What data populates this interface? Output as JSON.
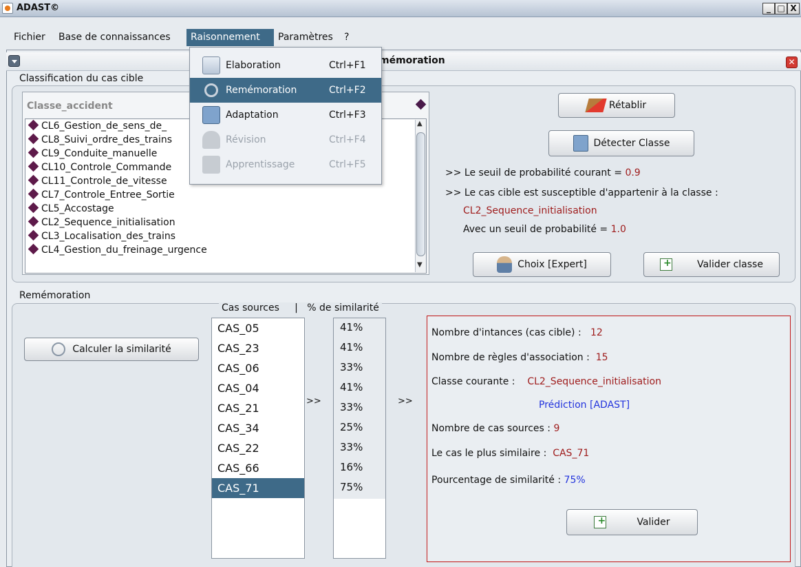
{
  "window": {
    "title": "ADAST©",
    "controls": [
      "_",
      "□",
      "X"
    ]
  },
  "menubar": {
    "items": [
      {
        "label": "Fichier"
      },
      {
        "label": "Base de connaissances"
      },
      {
        "label": "Raisonnement"
      },
      {
        "label": "Paramètres"
      },
      {
        "label": "?"
      }
    ]
  },
  "menu_dropdown": {
    "items": [
      {
        "label": "Elaboration",
        "shortcut": "Ctrl+F1",
        "icon": "elaboration-icon",
        "state": "enabled"
      },
      {
        "label": "Remémoration",
        "shortcut": "Ctrl+F2",
        "icon": "magnifier-icon",
        "state": "selected"
      },
      {
        "label": "Adaptation",
        "shortcut": "Ctrl+F3",
        "icon": "adaptation-icon",
        "state": "enabled"
      },
      {
        "label": "Révision",
        "shortcut": "Ctrl+F4",
        "icon": "person-icon",
        "state": "disabled"
      },
      {
        "label": "Apprentissage",
        "shortcut": "Ctrl+F5",
        "icon": "clipboard-icon",
        "state": "disabled"
      }
    ]
  },
  "internal_frame": {
    "title_visible": "mémoration"
  },
  "classification": {
    "section_label": "Classification du cas cible",
    "list_header": "Classe_accident",
    "items": [
      "CL6_Gestion_de_sens_de_",
      "CL8_Suivi_ordre_des_trains",
      "CL9_Conduite_manuelle",
      "CL10_Controle_Commande",
      "CL11_Controle_de_vitesse",
      "CL7_Controle_Entree_Sortie",
      "CL5_Accostage",
      "CL2_Sequence_initialisation",
      "CL3_Localisation_des_trains",
      "CL4_Gestion_du_freinage_urgence"
    ],
    "btn_retablir": "Rétablir",
    "btn_detecter": "Détecter Classe",
    "seuil_text": ">> Le seuil de probabilité courant =",
    "seuil_value": "0.9",
    "susceptible_text": ">> Le cas cible est susceptible d'appartenir à la classe :",
    "classe_value": "CL2_Sequence_initialisation",
    "avec_text": "Avec un seuil de probabilité =",
    "avec_value": "1.0",
    "btn_choix": "Choix [Expert]",
    "btn_valider_classe": "Valider classe"
  },
  "rememoration": {
    "section_label": "Remémoration",
    "col_sources": "Cas sources",
    "col_sep": "|",
    "col_sim": "% de similarité",
    "btn_calculer": "Calculer la similarité",
    "arrow": ">>",
    "sources": [
      "CAS_05",
      "CAS_23",
      "CAS_06",
      "CAS_04",
      "CAS_21",
      "CAS_34",
      "CAS_22",
      "CAS_66",
      "CAS_71"
    ],
    "similarities": [
      "41%",
      "41%",
      "33%",
      "41%",
      "33%",
      "25%",
      "33%",
      "16%",
      "75%"
    ],
    "selected_index": 8,
    "info": {
      "instances_label": "Nombre d'intances (cas cible) :",
      "instances_value": "12",
      "regles_label": "Nombre de règles d'association :",
      "regles_value": "15",
      "classe_label": "Classe courante :",
      "classe_value": "CL2_Sequence_initialisation",
      "prediction": "Prédiction [ADAST]",
      "nbsources_label": "Nombre de cas sources :",
      "nbsources_value": "9",
      "plus_similaire_label": "Le cas le plus similaire :",
      "plus_similaire_value": "CAS_71",
      "pourcentage_label": "Pourcentage de similarité :",
      "pourcentage_value": "75%",
      "btn_valider": "Valider"
    }
  },
  "colors": {
    "accent": "#3e6a88",
    "maroon": "#9e1a1a",
    "blue": "#2233dd",
    "border_red": "#c01616"
  }
}
